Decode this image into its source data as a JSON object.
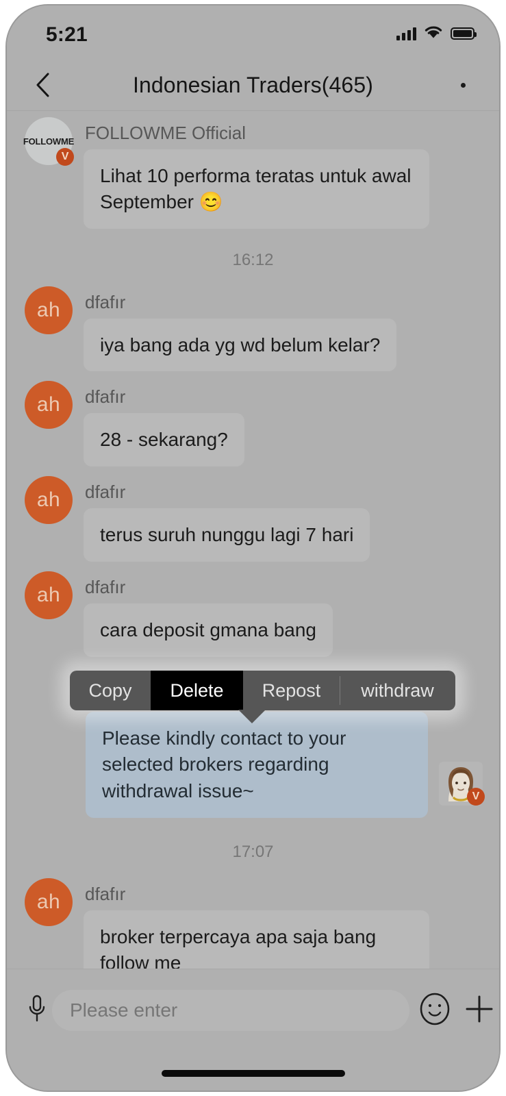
{
  "status_bar": {
    "time": "5:21",
    "signal_icon": "cellular-signal-icon",
    "wifi_icon": "wifi-icon",
    "battery_icon": "battery-full-icon"
  },
  "header": {
    "back_icon": "chevron-left-icon",
    "title": "Indonesian Traders(465)",
    "more_icon": "more-horizontal-icon"
  },
  "messages": [
    {
      "id": "m1",
      "direction": "incoming",
      "sender": "FOLLOWME Official",
      "avatar_type": "followme-logo",
      "avatar_label": "FOLLOWME",
      "verified": true,
      "text": "Lihat 10 performa teratas untuk awal September 😊"
    },
    {
      "id": "t1",
      "direction": "timestamp",
      "text": "16:12"
    },
    {
      "id": "m2",
      "direction": "incoming",
      "sender": "dfafır",
      "avatar_type": "initials",
      "avatar_label": "ah",
      "verified": false,
      "text": "iya bang ada yg wd belum kelar?"
    },
    {
      "id": "m3",
      "direction": "incoming",
      "sender": "dfafır",
      "avatar_type": "initials",
      "avatar_label": "ah",
      "verified": false,
      "text": "28  - sekarang?"
    },
    {
      "id": "m4",
      "direction": "incoming",
      "sender": "dfafır",
      "avatar_type": "initials",
      "avatar_label": "ah",
      "verified": false,
      "text": "terus suruh nunggu lagi 7 hari"
    },
    {
      "id": "m5",
      "direction": "incoming",
      "sender": "dfafır",
      "avatar_type": "initials",
      "avatar_label": "ah",
      "verified": false,
      "text": "cara deposit gmana bang"
    },
    {
      "id": "m6",
      "direction": "outgoing",
      "sender": "",
      "avatar_type": "photo",
      "verified": true,
      "text": "Please kindly contact to your selected brokers regarding withdrawal issue~"
    },
    {
      "id": "t2",
      "direction": "timestamp",
      "text": "17:07"
    },
    {
      "id": "m7",
      "direction": "incoming",
      "sender": "dfafır",
      "avatar_type": "initials",
      "avatar_label": "ah",
      "verified": false,
      "text": "broker terpercaya apa saja bang follow me"
    }
  ],
  "context_menu": {
    "items": [
      {
        "label": "Copy",
        "selected": false
      },
      {
        "label": "Delete",
        "selected": true
      },
      {
        "label": "Repost",
        "selected": false
      },
      {
        "label": "withdraw",
        "selected": false
      }
    ]
  },
  "input_bar": {
    "mic_icon": "microphone-icon",
    "placeholder": "Please enter",
    "value": "",
    "emoji_icon": "smiley-face-icon",
    "add_icon": "plus-icon"
  },
  "colors": {
    "screen_background": "#b0b0b0",
    "incoming_bubble": "#b9b9b9",
    "outgoing_bubble": "#aebdcb",
    "avatar_orange": "#cd5b28",
    "verified_badge": "#c1491c",
    "menu_background": "#565656",
    "menu_selected": "#000000"
  }
}
